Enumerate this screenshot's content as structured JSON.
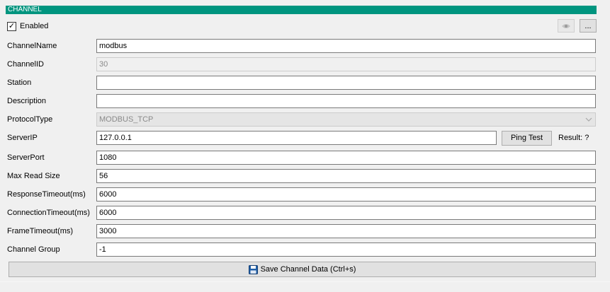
{
  "section": {
    "title": "CHANNEL"
  },
  "enabled": {
    "label": "Enabled",
    "checked": true,
    "check_glyph": "✓"
  },
  "toolbar": {
    "eye_icon": "eye-icon",
    "more_label": "..."
  },
  "fields": {
    "channel_name": {
      "label": "ChannelName",
      "value": "modbus"
    },
    "channel_id": {
      "label": "ChannelID",
      "value": "30"
    },
    "station": {
      "label": "Station",
      "value": ""
    },
    "description": {
      "label": "Description",
      "value": ""
    },
    "protocol_type": {
      "label": "ProtocolType",
      "value": "MODBUS_TCP"
    },
    "server_ip": {
      "label": "ServerIP",
      "value": "127.0.0.1"
    },
    "server_port": {
      "label": "ServerPort",
      "value": "1080"
    },
    "max_read_size": {
      "label": "Max Read Size",
      "value": "56"
    },
    "response_timeout": {
      "label": "ResponseTimeout(ms)",
      "value": "6000"
    },
    "connection_timeout": {
      "label": "ConnectionTimeout(ms)",
      "value": "6000"
    },
    "frame_timeout": {
      "label": "FrameTimeout(ms)",
      "value": "3000"
    },
    "channel_group": {
      "label": "Channel Group",
      "value": "-1"
    }
  },
  "ping": {
    "button_label": "Ping Test",
    "result_text": "Result: ?"
  },
  "save": {
    "label": "Save Channel Data (Ctrl+s)",
    "icon": "floppy-disk-icon"
  },
  "colors": {
    "header_bg": "#00957f",
    "background": "#f0f0f0",
    "save_icon": "#1f5fa8"
  }
}
